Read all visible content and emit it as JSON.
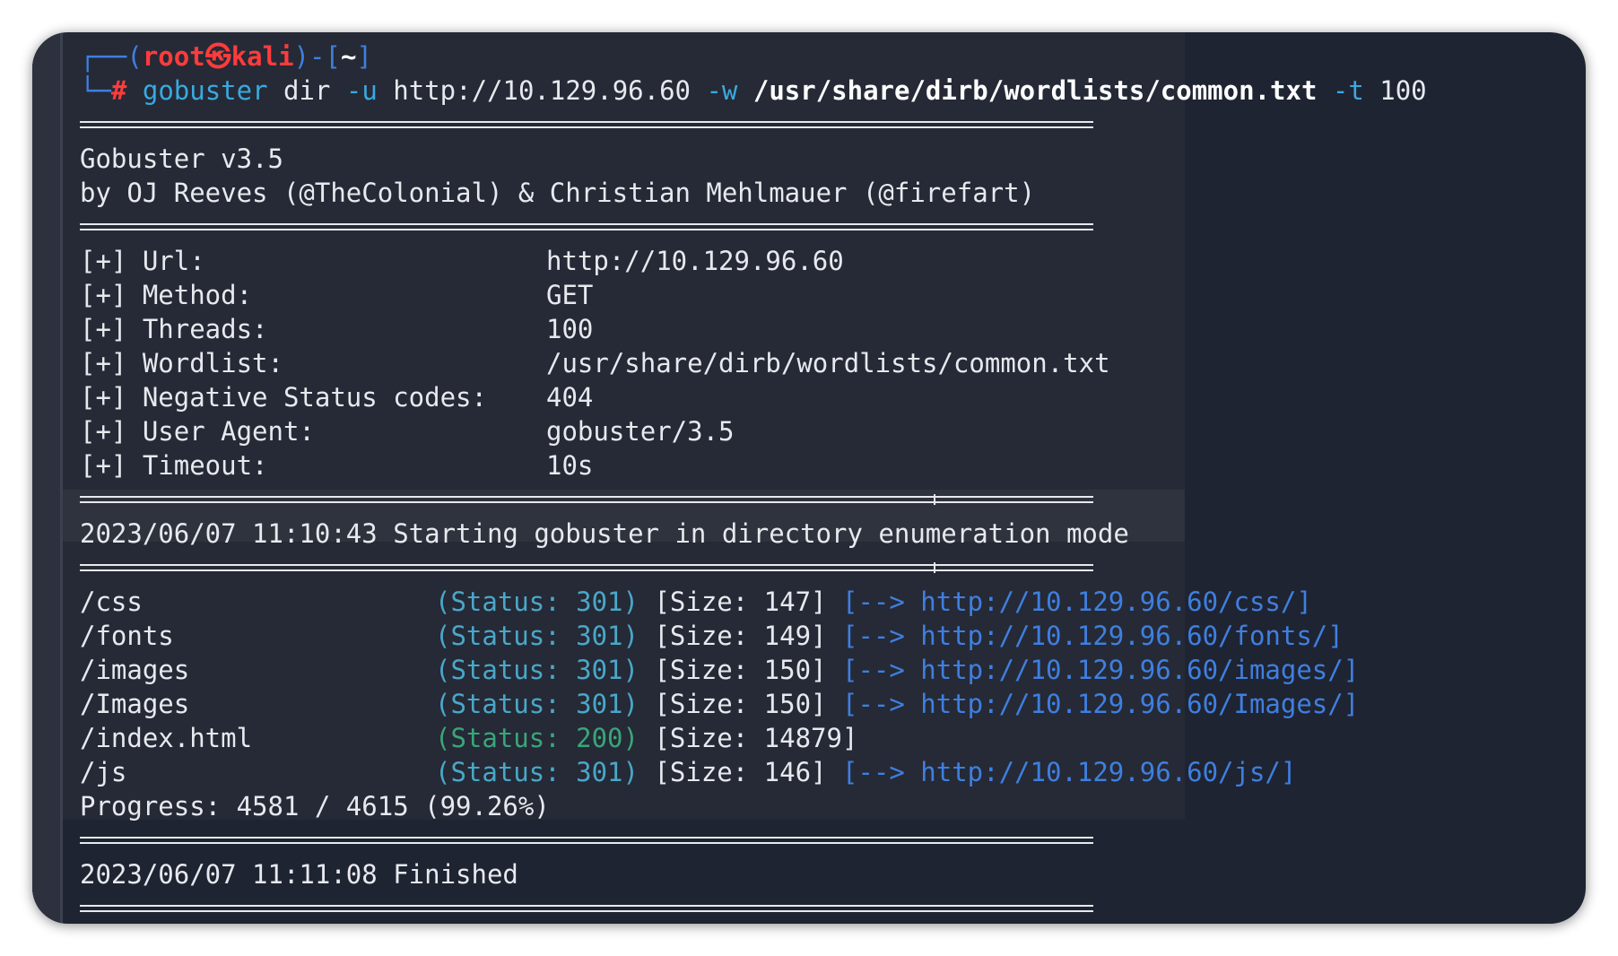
{
  "prompt": {
    "open": "┌──(",
    "user": "root",
    "at": "㉿",
    "host": "kali",
    "mid": ")-[",
    "dir": "~",
    "close": "]",
    "corner": "└─",
    "hash": "#"
  },
  "command": {
    "program": "gobuster",
    "subcommand": "dir",
    "url_flag": "-u",
    "url": "http://10.129.96.60",
    "wordlist_flag": "-w",
    "wordlist": "/usr/share/dirb/wordlists/common.txt",
    "threads_flag": "-t",
    "threads": "100"
  },
  "banner": {
    "version": "Gobuster v3.5",
    "authors": "by OJ Reeves (@TheColonial) & Christian Mehlmauer (@firefart)"
  },
  "config": [
    {
      "key": "[+] Url:",
      "value": "http://10.129.96.60"
    },
    {
      "key": "[+] Method:",
      "value": "GET"
    },
    {
      "key": "[+] Threads:",
      "value": "100"
    },
    {
      "key": "[+] Wordlist:",
      "value": "/usr/share/dirb/wordlists/common.txt"
    },
    {
      "key": "[+] Negative Status codes:",
      "value": "404"
    },
    {
      "key": "[+] User Agent:",
      "value": "gobuster/3.5"
    },
    {
      "key": "[+] Timeout:",
      "value": "10s"
    }
  ],
  "start_line": "2023/06/07 11:10:43 Starting gobuster in directory enumeration mode",
  "results": [
    {
      "path": "/css",
      "status": "(Status: 301)",
      "size": "[Size: 147]",
      "arrow": "[-->",
      "redirect": "http://10.129.96.60/css/]"
    },
    {
      "path": "/fonts",
      "status": "(Status: 301)",
      "size": "[Size: 149]",
      "arrow": "[-->",
      "redirect": "http://10.129.96.60/fonts/]"
    },
    {
      "path": "/images",
      "status": "(Status: 301)",
      "size": "[Size: 150]",
      "arrow": "[-->",
      "redirect": "http://10.129.96.60/images/]"
    },
    {
      "path": "/Images",
      "status": "(Status: 301)",
      "size": "[Size: 150]",
      "arrow": "[-->",
      "redirect": "http://10.129.96.60/Images/]"
    },
    {
      "path": "/index.html",
      "status": "(Status: 200)",
      "size": "[Size: 14879]",
      "arrow": "",
      "redirect": ""
    },
    {
      "path": "/js",
      "status": "(Status: 301)",
      "size": "[Size: 146]",
      "arrow": "[-->",
      "redirect": "http://10.129.96.60/js/]"
    }
  ],
  "progress": "Progress: 4581 / 4615 (99.26%)",
  "finish_line": "2023/06/07 11:11:08 Finished",
  "colors": {
    "background": "#1f2432",
    "prompt_red": "#ff3b3b",
    "prompt_frame": "#3f7fe0",
    "command_cyan": "#3aa9e0",
    "status_301": "#4aa7c9",
    "status_200": "#3aa57a",
    "link_blue": "#3f7fe0"
  }
}
